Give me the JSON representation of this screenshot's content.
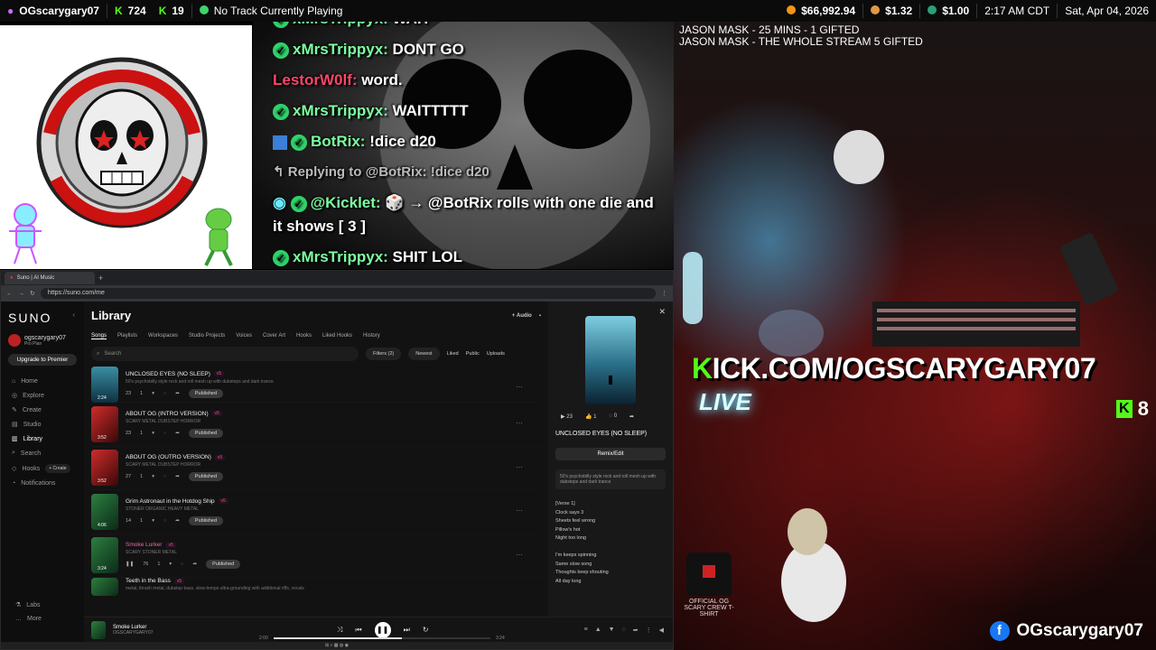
{
  "topbar": {
    "channel": "OGscarygary07",
    "kick_count": "724",
    "sub_count": "19",
    "now_playing": "No Track Currently Playing",
    "crypto1": "$66,992.94",
    "crypto2": "$1.32",
    "crypto3": "$1.00",
    "time": "2:17 AM CDT",
    "date": "Sat, Apr 04, 2026"
  },
  "logo": {
    "text": "OGSCARYGARY07 EST. 2021"
  },
  "chat": {
    "messages": [
      {
        "user": "xMrsTrippyx:",
        "text": "WAIT"
      },
      {
        "user": "xMrsTrippyx:",
        "text": "DONT GO"
      },
      {
        "user": "LestorW0lf:",
        "text": "word."
      },
      {
        "user": "xMrsTrippyx:",
        "text": "WAITTTTT"
      },
      {
        "user": "BotRix:",
        "text": "!dice d20"
      },
      {
        "reply": "Replying to @BotRix: !dice d20"
      },
      {
        "user": "@Kicklet:",
        "text": "🎲 → @BotRix rolls with one die and it shows [ 3 ]"
      },
      {
        "user": "xMrsTrippyx:",
        "text": "SHIT LOL"
      }
    ]
  },
  "camera": {
    "gift1": "JASON MASK - 25 MINS - 1 GIFTED",
    "gift2": "JASON MASK - THE WHOLE STREAM 5 GIFTED",
    "kick_url_k": "K",
    "kick_url_rest": "ICK.COM/OGSCARYGARY07",
    "live": "LIVE",
    "viewers": "8",
    "facebook": "OGscarygary07",
    "shirt_label": "OFFICIAL OG SCARY CREW T-SHIRT"
  },
  "browser": {
    "tab_title": "Suno | AI Music",
    "url": "https://suno.com/me"
  },
  "suno": {
    "brand": "SUNO",
    "username": "ogscarygary07",
    "plan": "Pro Plan",
    "upgrade": "Upgrade to Premier",
    "nav": [
      "Home",
      "Explore",
      "Create",
      "Studio",
      "Library",
      "Search",
      "Hooks",
      "Notifications"
    ],
    "hooks_create": "+ Create",
    "labs": "Labs",
    "more": "More",
    "library_title": "Library",
    "audio_btn": "+ Audio",
    "tabs": [
      "Songs",
      "Playlists",
      "Workspaces",
      "Studio Projects",
      "Voices",
      "Cover Art",
      "Hooks",
      "Liked Hooks",
      "History"
    ],
    "search_placeholder": "Search",
    "filters": "Filters (2)",
    "sort": "Newest",
    "toggles": [
      "Liked",
      "Public",
      "Uploads"
    ],
    "songs": [
      {
        "title": "UNCLOSED EYES (NO SLEEP)",
        "ver": "v5",
        "desc": "50's psychobilly style rock and roll mesh up with dubsteps and dark trance",
        "duration": "2:24",
        "plays": "23",
        "likes": "1",
        "status": "Published",
        "thumb": "blue"
      },
      {
        "title": "ABOUT OG (INTRO VERSION)",
        "ver": "v5",
        "desc": "SCARY METAL DUBSTEP HORROR",
        "duration": "3:52",
        "plays": "23",
        "likes": "1",
        "status": "Published",
        "thumb": "red"
      },
      {
        "title": "ABOUT OG (OUTRO VERSION)",
        "ver": "v5",
        "desc": "SCARY METAL DUBSTEP HORROR",
        "duration": "3:52",
        "plays": "27",
        "likes": "1",
        "status": "Published",
        "thumb": "red"
      },
      {
        "title": "Grim Astronaut in the Hotdog Ship",
        "ver": "v5",
        "desc": "STONER ORGANIC HEAVY METAL",
        "duration": "4:06",
        "plays": "14",
        "likes": "1",
        "status": "Published",
        "thumb": "green"
      },
      {
        "title": "Smoke Lurker",
        "ver": "v5",
        "desc": "SCARY STONER METAL",
        "duration": "3:24",
        "plays": "76",
        "likes": "1",
        "status": "Published",
        "thumb": "green"
      },
      {
        "title": "Teeth in the Bass",
        "ver": "v5",
        "desc": "metal, thrash metal, dubstep bass, slow-tempo ultra-grounding with additional riffs, vocals",
        "duration": "",
        "plays": "",
        "likes": "",
        "status": "",
        "thumb": "green"
      }
    ],
    "detail": {
      "plays": "23",
      "likes": "1",
      "comments": "0",
      "title": "UNCLOSED EYES (NO SLEEP)",
      "remix": "Remix/Edit",
      "style": "50's psychobilly style rock and roll mesh up with dubsteps and dark trance",
      "lyrics": [
        "[Verse 1]",
        "Clock says 3",
        "Sheets feel wrong",
        "Pillow's hot",
        "Night too long",
        "",
        "I'm keeps spinning",
        "Same slow song",
        "Thoughts keep shouting",
        "All day long"
      ]
    },
    "player": {
      "title": "Smoke Lurker",
      "artist": "OGSCARYGARY07",
      "elapsed": "2:00",
      "total": "3:24",
      "progress": 0.59
    }
  }
}
